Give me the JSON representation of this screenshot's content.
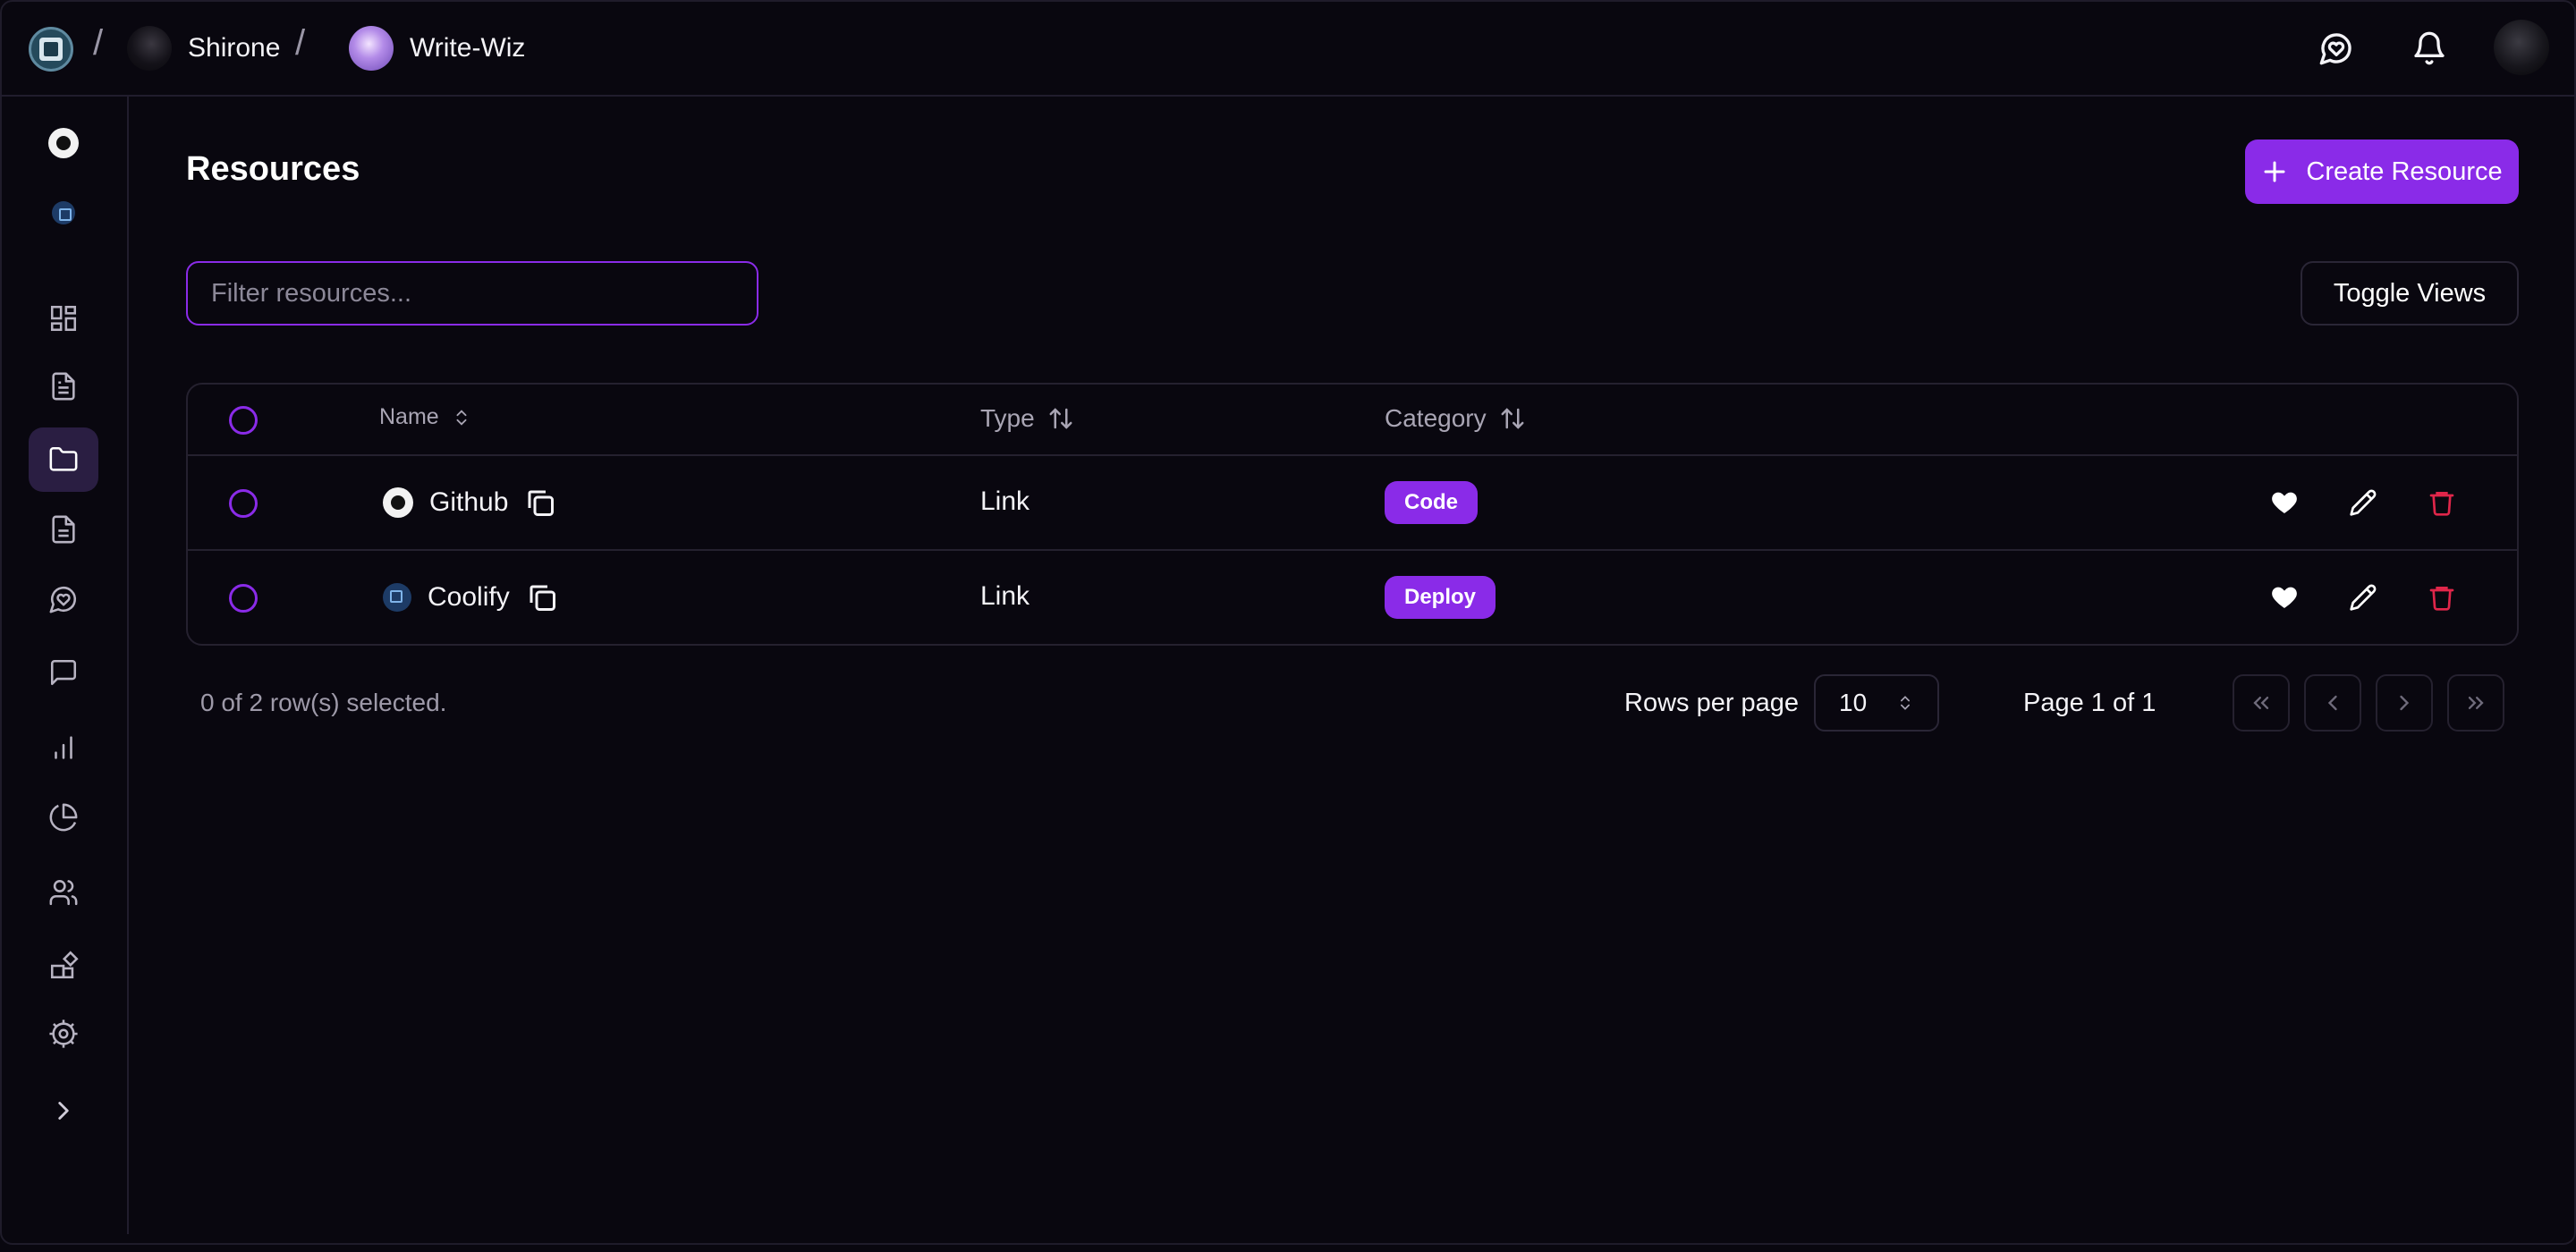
{
  "breadcrumb": {
    "workspace": "Shirone",
    "project": "Write-Wiz"
  },
  "page": {
    "title": "Resources",
    "create_label": "Create Resource",
    "filter_placeholder": "Filter resources...",
    "toggle_views_label": "Toggle Views"
  },
  "table": {
    "columns": {
      "name": "Name",
      "type": "Type",
      "category": "Category"
    },
    "rows": [
      {
        "name": "Github",
        "type": "Link",
        "category": "Code",
        "icon": "github-icon"
      },
      {
        "name": "Coolify",
        "type": "Link",
        "category": "Deploy",
        "icon": "coolify-icon"
      }
    ]
  },
  "footer": {
    "selection_status": "0 of 2 row(s) selected.",
    "rows_per_page_label": "Rows per page",
    "rows_per_page_value": "10",
    "page_info": "Page 1 of 1"
  },
  "sidebar": {
    "items": [
      "github-icon",
      "coolify-icon",
      "dashboard-icon",
      "document-icon",
      "folder-icon",
      "file-text-icon",
      "chat-bubble-icon",
      "message-icon",
      "bar-chart-icon",
      "pie-chart-icon",
      "users-icon",
      "integrations-icon",
      "settings-icon",
      "chevron-right-icon"
    ],
    "active": "folder-icon"
  },
  "colors": {
    "accent": "#8a2be8",
    "background": "#09070f",
    "danger": "#e0264a"
  }
}
